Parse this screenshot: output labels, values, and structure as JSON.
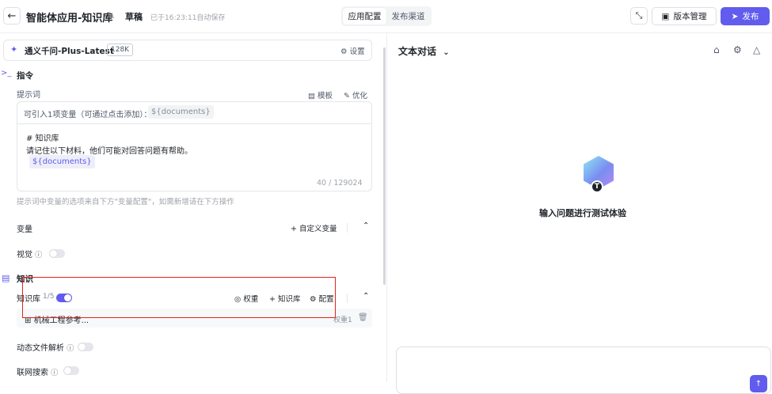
{
  "header": {
    "back_icon": "arrow-left-icon",
    "title": "智能体应用-知识库",
    "status": "草稿",
    "saved_text": "已于16:23:11自动保存",
    "tabs": [
      {
        "label": "应用配置",
        "active": true
      },
      {
        "label": "发布渠道",
        "active": false
      }
    ],
    "version_label": "版本管理",
    "publish_label": "发布"
  },
  "model": {
    "name": "通义千问-Plus-Latest",
    "context": "128K",
    "settings_label": "设置"
  },
  "instruction": {
    "section_title": "指令",
    "prompt_label": "提示词",
    "template_label": "模板",
    "optimize_label": "优化",
    "variable_hint": "可引入1项变量（可通过点击添加）：",
    "variable_chip": "${documents}",
    "prompt_line1": "# 知识库",
    "prompt_line2": "请记住以下材料，他们可能对回答问题有帮助。",
    "prompt_chip": "${documents}",
    "char_count": "40 / 129024",
    "hint": "提示词中变量的选项来自下方\"变量配置\"，如需新增请在下方操作"
  },
  "variables": {
    "label": "变量",
    "custom_label": "自定义变量"
  },
  "vision": {
    "label": "视觉",
    "enabled": false
  },
  "knowledge": {
    "section_title": "知识",
    "kb_label": "知识库",
    "kb_count": "1/5",
    "kb_enabled": true,
    "weight_action": "权重",
    "add_action": "知识库",
    "config_action": "配置",
    "items": [
      {
        "name": "机械工程参考...",
        "weight": "权重1"
      }
    ]
  },
  "dynamic_file": {
    "label": "动态文件解析",
    "enabled": false
  },
  "web_search": {
    "label": "联网搜索",
    "enabled": false
  },
  "chat": {
    "mode_label": "文本对话",
    "empty_text": "输入问题进行测试体验",
    "badge_letter": "T"
  },
  "colors": {
    "accent": "#615ced",
    "highlight_box": "#e0251b"
  }
}
